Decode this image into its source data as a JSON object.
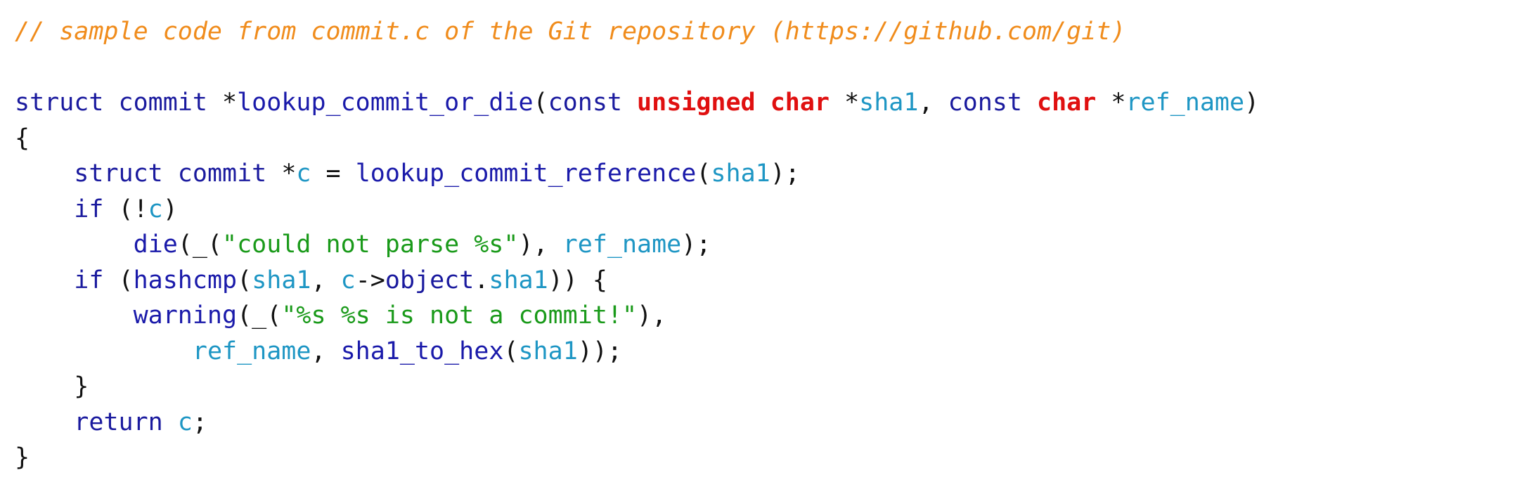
{
  "colors": {
    "comment": "#f08c1c",
    "keyword": "#1a1a9e",
    "type": "#e01010",
    "function": "#1a1aaa",
    "variable": "#1e96c4",
    "string": "#1a9a1a",
    "punctuation": "#111111",
    "background": "#ffffff"
  },
  "lines": [
    [
      {
        "k": "comment",
        "t": "// sample code from commit.c of the Git repository (https://github.com/git)"
      }
    ],
    [],
    [
      {
        "k": "keyword",
        "t": "struct commit "
      },
      {
        "k": "punct",
        "t": "*"
      },
      {
        "k": "func",
        "t": "lookup_commit_or_die"
      },
      {
        "k": "punct",
        "t": "("
      },
      {
        "k": "keyword",
        "t": "const "
      },
      {
        "k": "type",
        "t": "unsigned char "
      },
      {
        "k": "punct",
        "t": "*"
      },
      {
        "k": "var",
        "t": "sha1"
      },
      {
        "k": "punct",
        "t": ", "
      },
      {
        "k": "keyword",
        "t": "const "
      },
      {
        "k": "type",
        "t": "char "
      },
      {
        "k": "punct",
        "t": "*"
      },
      {
        "k": "var",
        "t": "ref_name"
      },
      {
        "k": "punct",
        "t": ")"
      }
    ],
    [
      {
        "k": "punct",
        "t": "{"
      }
    ],
    [
      {
        "k": "plain",
        "t": "    "
      },
      {
        "k": "keyword",
        "t": "struct commit "
      },
      {
        "k": "punct",
        "t": "*"
      },
      {
        "k": "var",
        "t": "c"
      },
      {
        "k": "punct",
        "t": " = "
      },
      {
        "k": "func",
        "t": "lookup_commit_reference"
      },
      {
        "k": "punct",
        "t": "("
      },
      {
        "k": "var",
        "t": "sha1"
      },
      {
        "k": "punct",
        "t": ");"
      }
    ],
    [
      {
        "k": "plain",
        "t": "    "
      },
      {
        "k": "keyword",
        "t": "if "
      },
      {
        "k": "punct",
        "t": "(!"
      },
      {
        "k": "var",
        "t": "c"
      },
      {
        "k": "punct",
        "t": ")"
      }
    ],
    [
      {
        "k": "plain",
        "t": "        "
      },
      {
        "k": "func",
        "t": "die"
      },
      {
        "k": "punct",
        "t": "(_("
      },
      {
        "k": "string",
        "t": "\"could not parse %s\""
      },
      {
        "k": "punct",
        "t": "), "
      },
      {
        "k": "var",
        "t": "ref_name"
      },
      {
        "k": "punct",
        "t": ");"
      }
    ],
    [
      {
        "k": "plain",
        "t": "    "
      },
      {
        "k": "keyword",
        "t": "if "
      },
      {
        "k": "punct",
        "t": "("
      },
      {
        "k": "func",
        "t": "hashcmp"
      },
      {
        "k": "punct",
        "t": "("
      },
      {
        "k": "var",
        "t": "sha1"
      },
      {
        "k": "punct",
        "t": ", "
      },
      {
        "k": "var",
        "t": "c"
      },
      {
        "k": "punct",
        "t": "->"
      },
      {
        "k": "keyword",
        "t": "object"
      },
      {
        "k": "punct",
        "t": "."
      },
      {
        "k": "var",
        "t": "sha1"
      },
      {
        "k": "punct",
        "t": ")) {"
      }
    ],
    [
      {
        "k": "plain",
        "t": "        "
      },
      {
        "k": "func",
        "t": "warning"
      },
      {
        "k": "punct",
        "t": "(_("
      },
      {
        "k": "string",
        "t": "\"%s %s is not a commit!\""
      },
      {
        "k": "punct",
        "t": "),"
      }
    ],
    [
      {
        "k": "plain",
        "t": "            "
      },
      {
        "k": "var",
        "t": "ref_name"
      },
      {
        "k": "punct",
        "t": ", "
      },
      {
        "k": "func",
        "t": "sha1_to_hex"
      },
      {
        "k": "punct",
        "t": "("
      },
      {
        "k": "var",
        "t": "sha1"
      },
      {
        "k": "punct",
        "t": "));"
      }
    ],
    [
      {
        "k": "plain",
        "t": "    "
      },
      {
        "k": "punct",
        "t": "}"
      }
    ],
    [
      {
        "k": "plain",
        "t": "    "
      },
      {
        "k": "keyword",
        "t": "return "
      },
      {
        "k": "var",
        "t": "c"
      },
      {
        "k": "punct",
        "t": ";"
      }
    ],
    [
      {
        "k": "punct",
        "t": "}"
      }
    ]
  ]
}
